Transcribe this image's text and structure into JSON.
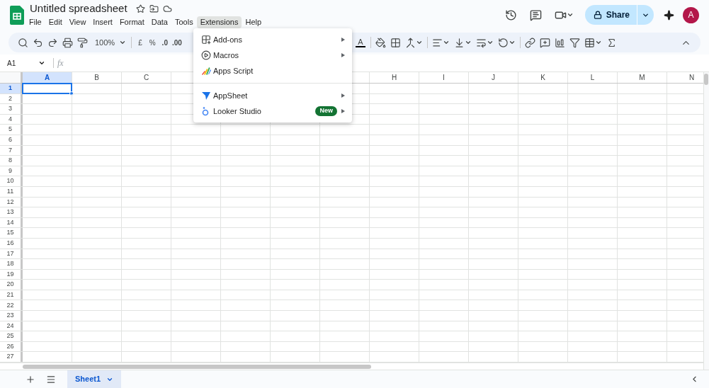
{
  "document": {
    "title": "Untitled spreadsheet"
  },
  "menubar": [
    {
      "label": "File",
      "selected": false
    },
    {
      "label": "Edit",
      "selected": false
    },
    {
      "label": "View",
      "selected": false
    },
    {
      "label": "Insert",
      "selected": false
    },
    {
      "label": "Format",
      "selected": false
    },
    {
      "label": "Data",
      "selected": false
    },
    {
      "label": "Tools",
      "selected": false
    },
    {
      "label": "Extensions",
      "selected": true
    },
    {
      "label": "Help",
      "selected": false
    }
  ],
  "share_button": {
    "label": "Share"
  },
  "account": {
    "initial": "A"
  },
  "toolbar": {
    "zoom": "100%",
    "currency": "£",
    "percent": "%",
    "decrease_decimals": ".0",
    "increase_decimals": ".00",
    "text_color_letter": "A"
  },
  "formula_bar": {
    "cell_reference": "A1",
    "fx_label": "fx"
  },
  "grid": {
    "columns": [
      {
        "label": "A",
        "selected": true
      },
      {
        "label": "B",
        "selected": false
      },
      {
        "label": "C",
        "selected": false
      },
      {
        "label": "H",
        "selected": false
      },
      {
        "label": "I",
        "selected": false
      },
      {
        "label": "J",
        "selected": false
      },
      {
        "label": "K",
        "selected": false
      },
      {
        "label": "L",
        "selected": false
      },
      {
        "label": "M",
        "selected": false
      },
      {
        "label": "N",
        "selected": false
      }
    ],
    "rows": [
      {
        "label": "1",
        "selected": true
      },
      {
        "label": "2",
        "selected": false
      },
      {
        "label": "3",
        "selected": false
      },
      {
        "label": "4",
        "selected": false
      },
      {
        "label": "5",
        "selected": false
      },
      {
        "label": "6",
        "selected": false
      },
      {
        "label": "7",
        "selected": false
      },
      {
        "label": "8",
        "selected": false
      },
      {
        "label": "9",
        "selected": false
      },
      {
        "label": "10",
        "selected": false
      },
      {
        "label": "11",
        "selected": false
      },
      {
        "label": "12",
        "selected": false
      },
      {
        "label": "13",
        "selected": false
      },
      {
        "label": "14",
        "selected": false
      },
      {
        "label": "15",
        "selected": false
      },
      {
        "label": "16",
        "selected": false
      },
      {
        "label": "17",
        "selected": false
      },
      {
        "label": "18",
        "selected": false
      },
      {
        "label": "19",
        "selected": false
      },
      {
        "label": "20",
        "selected": false
      },
      {
        "label": "21",
        "selected": false
      },
      {
        "label": "22",
        "selected": false
      },
      {
        "label": "23",
        "selected": false
      },
      {
        "label": "24",
        "selected": false
      },
      {
        "label": "25",
        "selected": false
      },
      {
        "label": "26",
        "selected": false
      },
      {
        "label": "27",
        "selected": false
      }
    ]
  },
  "extensions_menu": {
    "groups": [
      [
        {
          "label": "Add-ons",
          "kind": "addons",
          "submenu": true
        },
        {
          "label": "Macros",
          "kind": "macros",
          "submenu": true
        },
        {
          "label": "Apps Script",
          "kind": "script",
          "submenu": false
        }
      ],
      [
        {
          "label": "AppSheet",
          "kind": "appsheet",
          "submenu": true
        },
        {
          "label": "Looker Studio",
          "kind": "looker",
          "submenu": true,
          "badge": "New"
        }
      ]
    ]
  },
  "sheet_tabs": [
    {
      "label": "Sheet1",
      "selected": true
    }
  ]
}
